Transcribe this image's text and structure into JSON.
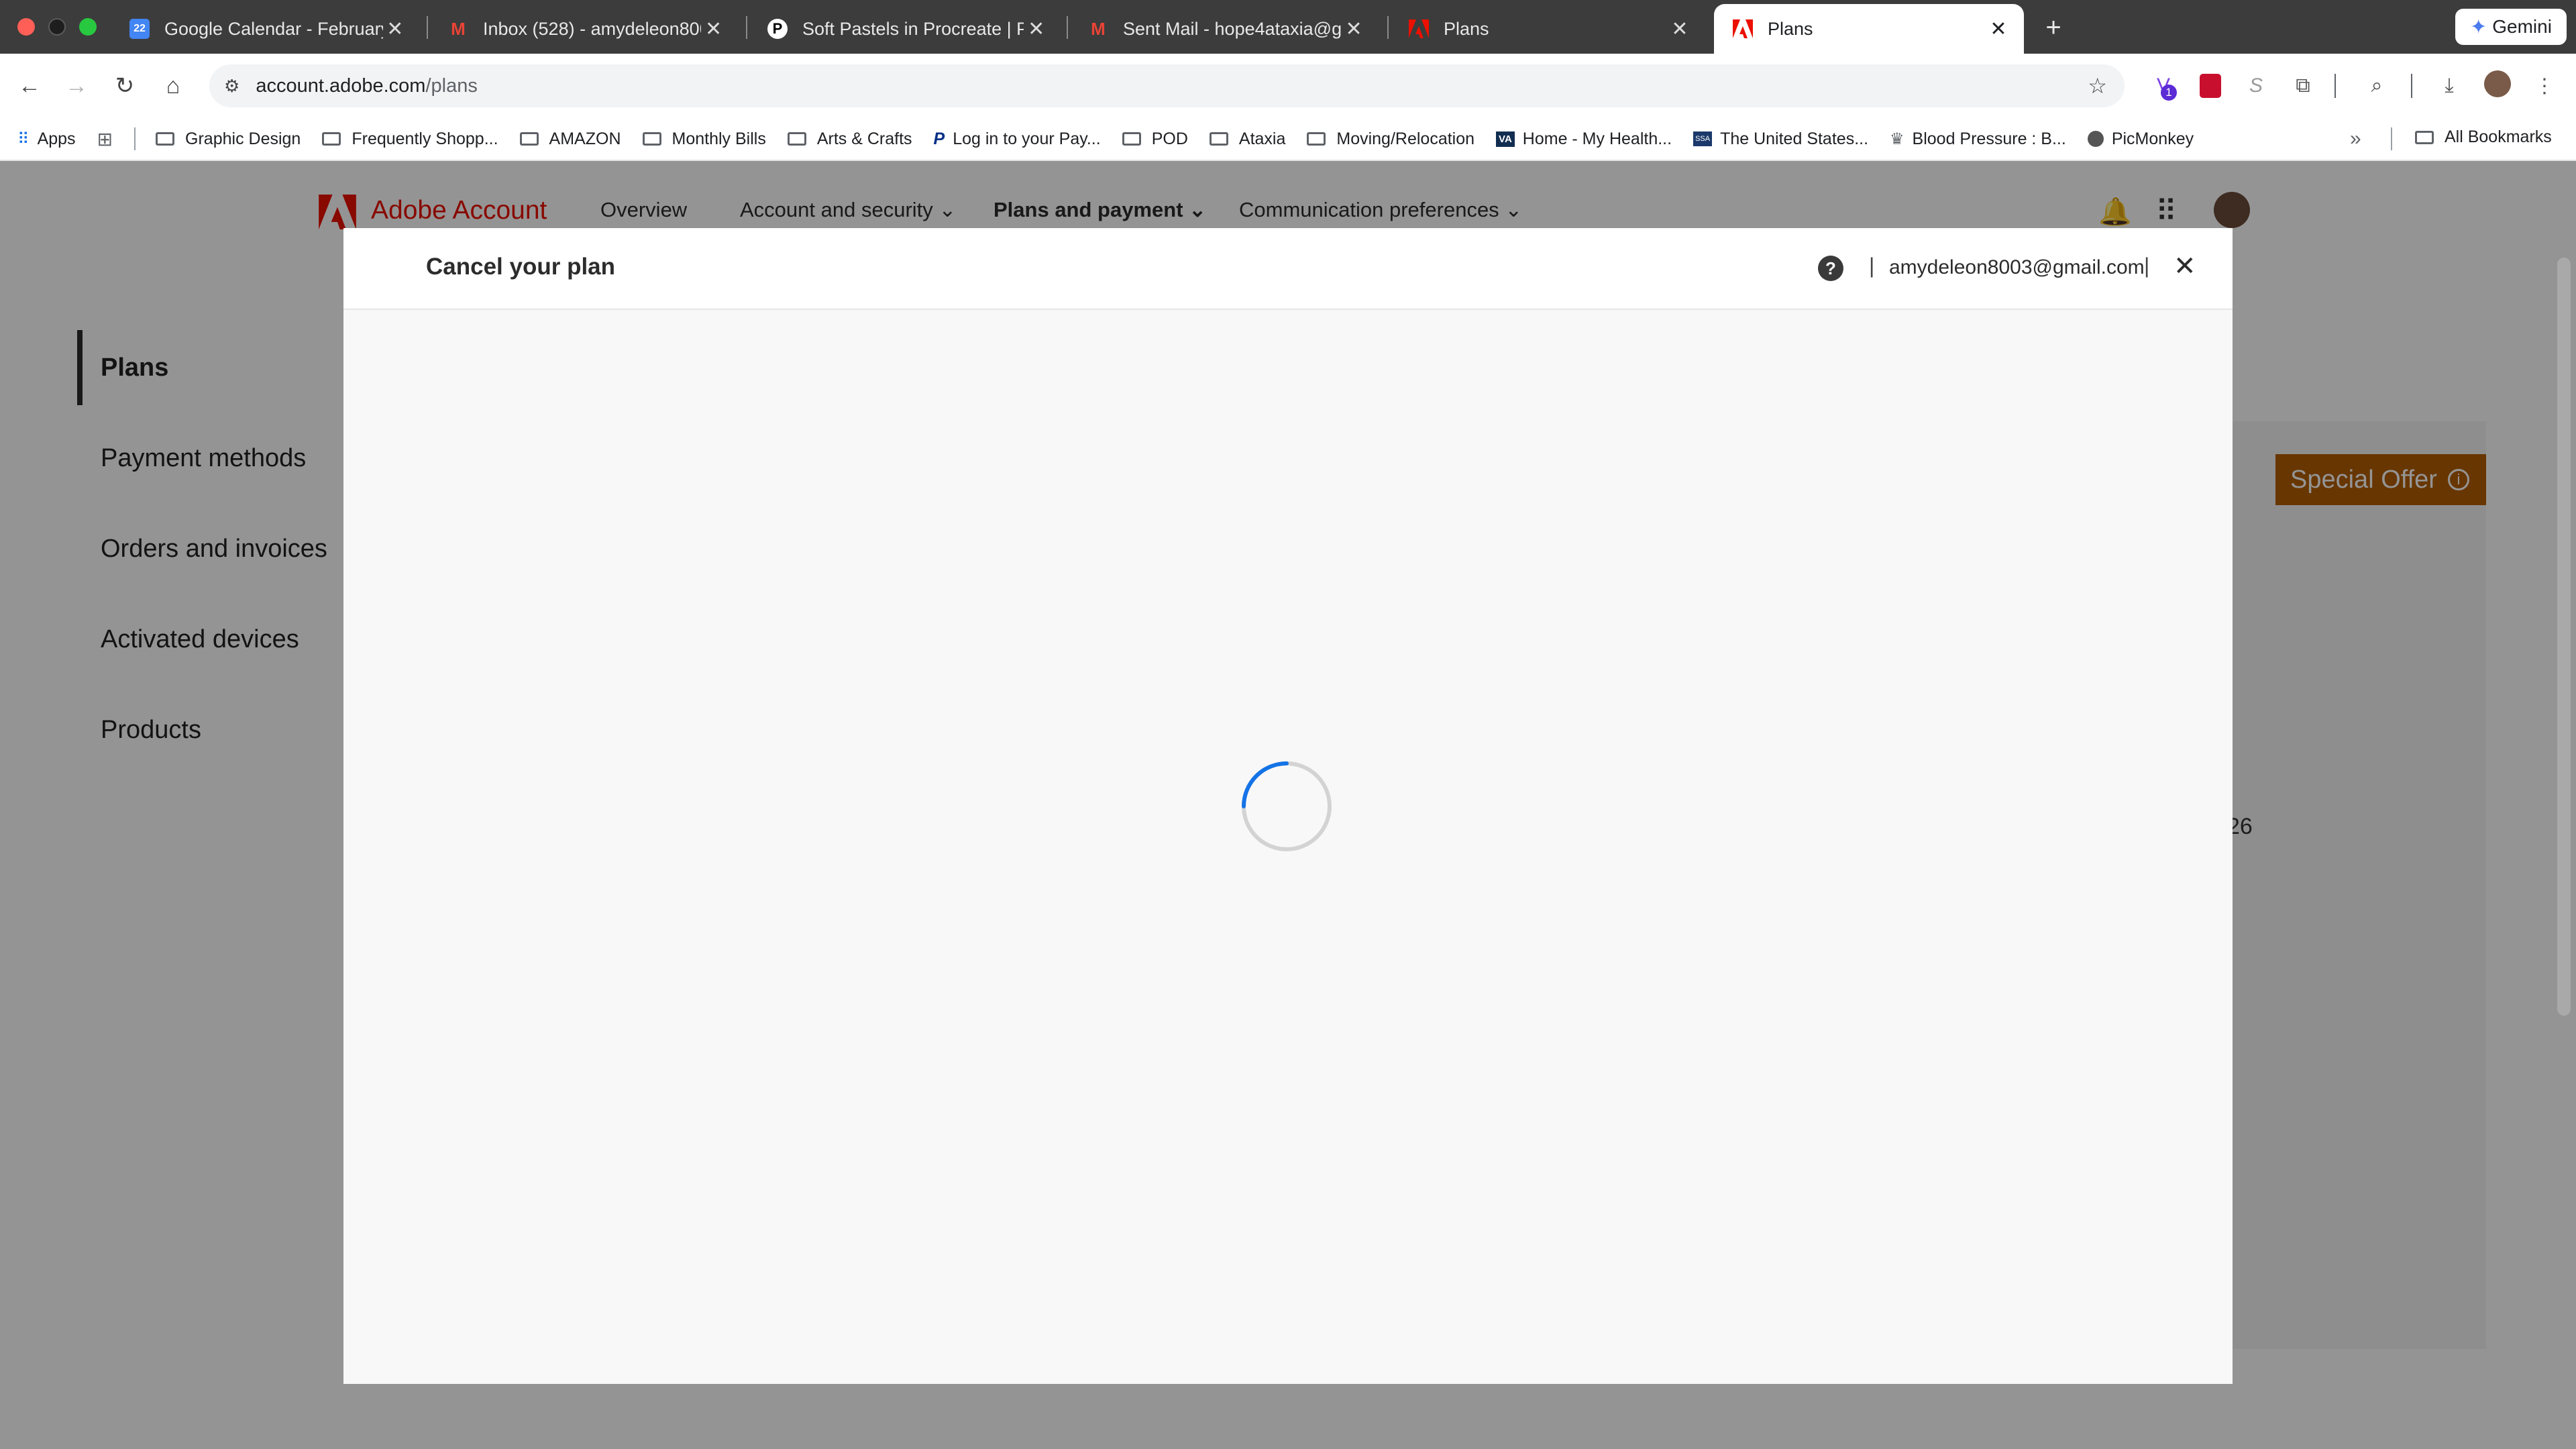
{
  "browser": {
    "tabs": [
      {
        "title": "Google Calendar - February 2",
        "icon": "google-calendar-icon"
      },
      {
        "title": "Inbox (528) - amydeleon8003",
        "icon": "gmail-icon"
      },
      {
        "title": "Soft Pastels in Procreate | Pat",
        "icon": "patreon-icon"
      },
      {
        "title": "Sent Mail - hope4ataxia@gma",
        "icon": "gmail-icon"
      },
      {
        "title": "Plans",
        "icon": "adobe-icon"
      },
      {
        "title": "Plans",
        "icon": "adobe-icon",
        "active": true
      }
    ],
    "new_tab": "+",
    "gemini_label": "Gemini",
    "url_host": "account.adobe.com",
    "url_path": "/plans",
    "extension_badge": "1"
  },
  "bookmarks": {
    "apps_label": "Apps",
    "items": [
      {
        "label": "Graphic Design",
        "icon": "folder-icon"
      },
      {
        "label": "Frequently Shopp...",
        "icon": "folder-icon"
      },
      {
        "label": "AMAZON",
        "icon": "folder-icon"
      },
      {
        "label": "Monthly Bills",
        "icon": "folder-icon"
      },
      {
        "label": "Arts & Crafts",
        "icon": "folder-icon"
      },
      {
        "label": "Log in to your Pay...",
        "icon": "paypal-icon"
      },
      {
        "label": "POD",
        "icon": "folder-icon"
      },
      {
        "label": "Ataxia",
        "icon": "folder-icon"
      },
      {
        "label": "Moving/Relocation",
        "icon": "folder-icon"
      },
      {
        "label": "Home - My Health...",
        "icon": "va-icon"
      },
      {
        "label": "The United States...",
        "icon": "ssa-icon"
      },
      {
        "label": "Blood Pressure : B...",
        "icon": "crown-icon"
      },
      {
        "label": "PicMonkey",
        "icon": "picmonkey-icon"
      }
    ],
    "overflow": "»",
    "all_bookmarks": "All Bookmarks"
  },
  "site": {
    "brand": "Adobe Account",
    "nav": [
      "Overview",
      "Account and security",
      "Plans and payment",
      "Communication preferences"
    ],
    "sidebar": [
      "Plans",
      "Payment methods",
      "Orders and invoices",
      "Activated devices",
      "Products"
    ],
    "special_offer": "Special Offer",
    "partial_text": "26"
  },
  "modal": {
    "title": "Cancel your plan",
    "email": "amydeleon8003@gmail.com",
    "separator": "|",
    "loading_state": "spinner"
  },
  "colors": {
    "adobe_red": "#eb1000",
    "special_offer": "#b35e00",
    "spinner": "#1473e6"
  }
}
